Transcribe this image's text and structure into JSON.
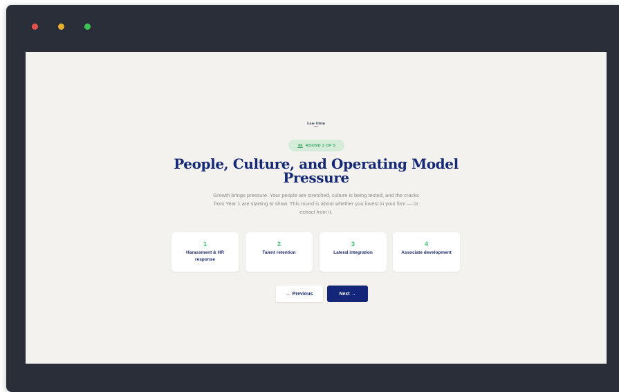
{
  "window": {
    "controls": [
      "close",
      "minimize",
      "maximize"
    ]
  },
  "brand": {
    "logo_text": "Law Firm",
    "logo_subtext": "Sim"
  },
  "round_badge": {
    "icon": "people-icon",
    "text": "ROUND 2 OF 5"
  },
  "heading": {
    "title_line1": "People, Culture, and Operating Model",
    "title_line2": "Pressure",
    "description": "Growth brings pressure. Your people are stretched, culture is being tested, and the cracks from Year 1 are starting to show. This round is about whether you invest in your firm — or extract from it."
  },
  "topics": [
    {
      "number": "1",
      "label": "Harassment & HR response"
    },
    {
      "number": "2",
      "label": "Talent retention"
    },
    {
      "number": "3",
      "label": "Lateral integration"
    },
    {
      "number": "4",
      "label": "Associate development"
    }
  ],
  "nav": {
    "previous_label": "← Previous",
    "next_label": "Next →"
  },
  "colors": {
    "window_frame": "#2a2e38",
    "page_background": "#f4f2ee",
    "title_navy": "#152874",
    "accent_green": "#3bbf72",
    "badge_background": "#d5ecd9",
    "primary_button": "#13267a"
  }
}
